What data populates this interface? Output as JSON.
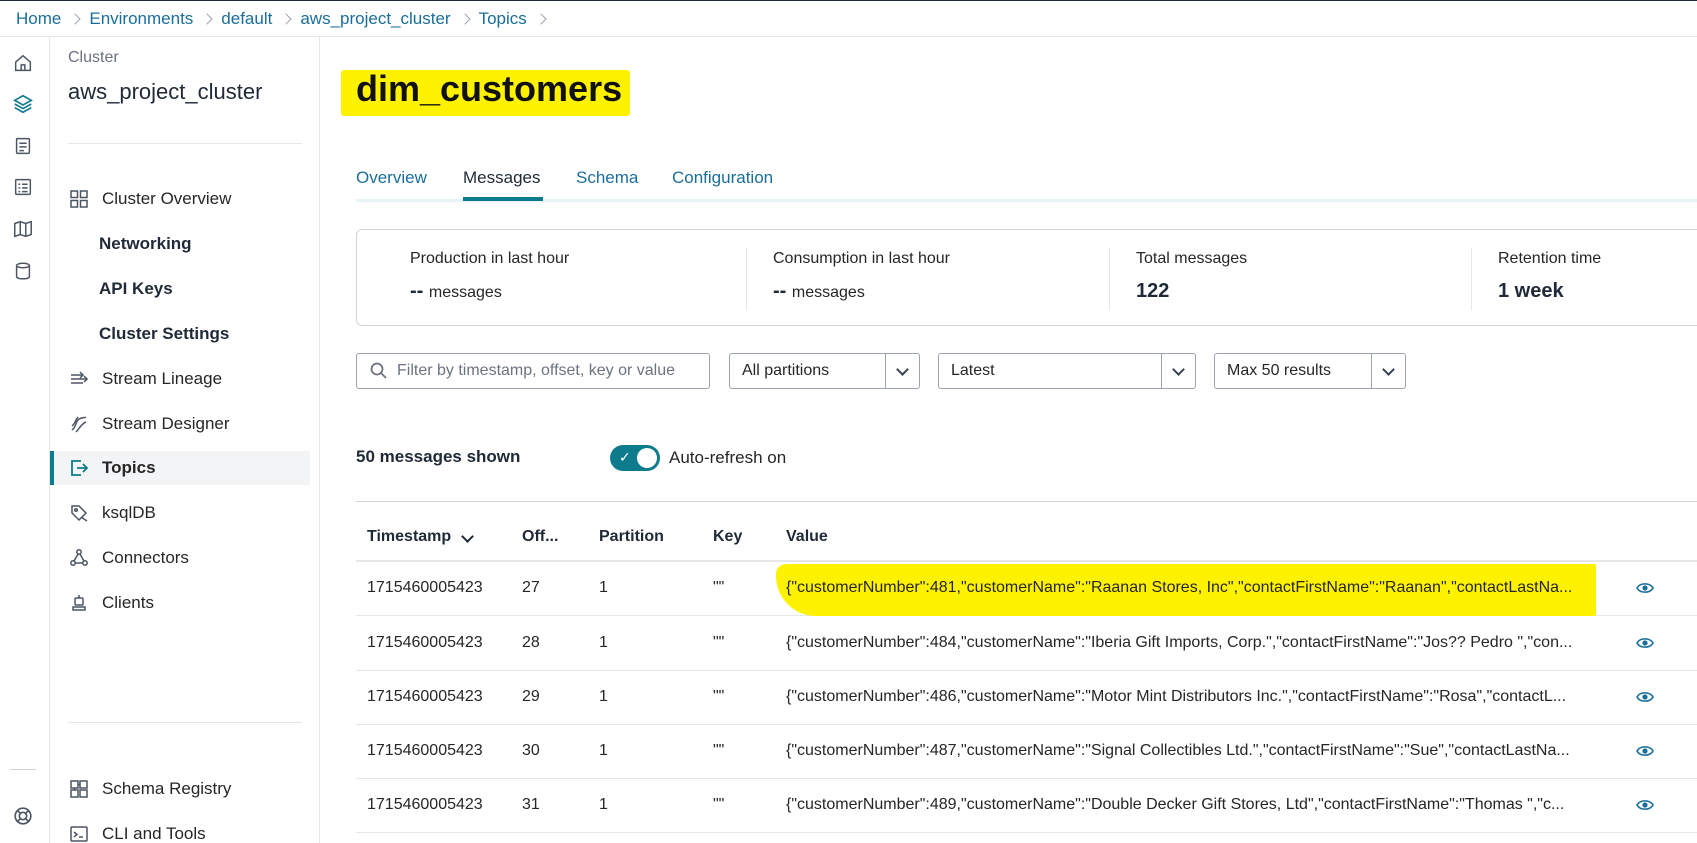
{
  "breadcrumb": [
    "Home",
    "Environments",
    "default",
    "aws_project_cluster",
    "Topics"
  ],
  "rail_icons": [
    "home-icon",
    "layers-icon",
    "document-icon",
    "list-icon",
    "map-icon",
    "database-icon",
    "help-icon"
  ],
  "sidebar": {
    "cluster_label": "Cluster",
    "cluster_name": "aws_project_cluster",
    "items": [
      {
        "label": "Cluster Overview",
        "icon": "grid-icon"
      },
      {
        "label": "Networking"
      },
      {
        "label": "API Keys"
      },
      {
        "label": "Cluster Settings"
      },
      {
        "label": "Stream Lineage",
        "icon": "lineage-icon"
      },
      {
        "label": "Stream Designer",
        "icon": "designer-icon"
      },
      {
        "label": "Topics",
        "icon": "topics-icon",
        "active": true
      },
      {
        "label": "ksqlDB",
        "icon": "ksqldb-icon"
      },
      {
        "label": "Connectors",
        "icon": "connectors-icon"
      },
      {
        "label": "Clients",
        "icon": "clients-icon"
      }
    ],
    "bottom_items": [
      {
        "label": "Schema Registry",
        "icon": "schema-icon"
      },
      {
        "label": "CLI and Tools",
        "icon": "terminal-icon"
      }
    ]
  },
  "topic": {
    "title": "dim_customers"
  },
  "tabs": [
    "Overview",
    "Messages",
    "Schema",
    "Configuration"
  ],
  "active_tab": "Messages",
  "stats": {
    "production": {
      "label": "Production in last hour",
      "value": "--",
      "unit": "messages"
    },
    "consumption": {
      "label": "Consumption in last hour",
      "value": "--",
      "unit": "messages"
    },
    "total": {
      "label": "Total messages",
      "value": "122"
    },
    "retention": {
      "label": "Retention time",
      "value": "1 week"
    }
  },
  "filter": {
    "placeholder": "Filter by timestamp, offset, key or value"
  },
  "selects": {
    "partitions": "All partitions",
    "position": "Latest",
    "max_results": "Max 50 results"
  },
  "messages_shown": "50 messages shown",
  "auto_refresh": {
    "label": "Auto-refresh on",
    "on": true
  },
  "table": {
    "headers": [
      "Timestamp",
      "Off...",
      "Partition",
      "Key",
      "Value"
    ],
    "rows": [
      {
        "timestamp": "1715460005423",
        "offset": "27",
        "partition": "1",
        "key": "\"\"",
        "value": "{\"customerNumber\":481,\"customerName\":\"Raanan Stores, Inc\",\"contactFirstName\":\"Raanan\",\"contactLastNa..."
      },
      {
        "timestamp": "1715460005423",
        "offset": "28",
        "partition": "1",
        "key": "\"\"",
        "value": "{\"customerNumber\":484,\"customerName\":\"Iberia Gift Imports, Corp.\",\"contactFirstName\":\"Jos?? Pedro \",\"con..."
      },
      {
        "timestamp": "1715460005423",
        "offset": "29",
        "partition": "1",
        "key": "\"\"",
        "value": "{\"customerNumber\":486,\"customerName\":\"Motor Mint Distributors Inc.\",\"contactFirstName\":\"Rosa\",\"contactL..."
      },
      {
        "timestamp": "1715460005423",
        "offset": "30",
        "partition": "1",
        "key": "\"\"",
        "value": "{\"customerNumber\":487,\"customerName\":\"Signal Collectibles Ltd.\",\"contactFirstName\":\"Sue\",\"contactLastNa..."
      },
      {
        "timestamp": "1715460005423",
        "offset": "31",
        "partition": "1",
        "key": "\"\"",
        "value": "{\"customerNumber\":489,\"customerName\":\"Double Decker Gift Stores, Ltd\",\"contactFirstName\":\"Thomas \",\"c..."
      }
    ]
  },
  "colors": {
    "link": "#1a6e9a",
    "accent": "#0e7b8c",
    "highlight": "#fff200"
  }
}
